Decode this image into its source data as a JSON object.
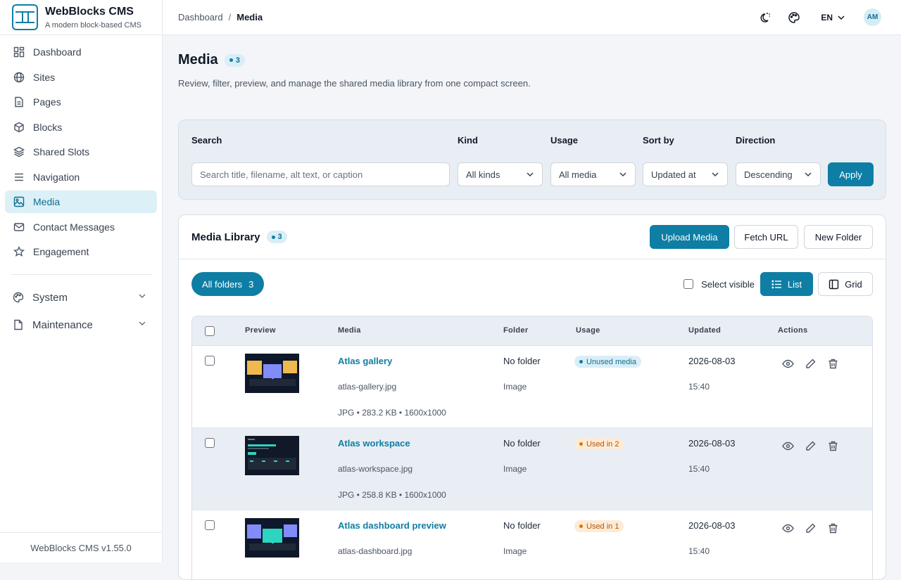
{
  "brand": {
    "name": "WebBlocks CMS",
    "tagline": "A modern block-based CMS",
    "version": "WebBlocks CMS v1.55.0"
  },
  "sidebar": {
    "items": [
      {
        "label": "Dashboard",
        "icon": "dashboard-grid-icon"
      },
      {
        "label": "Sites",
        "icon": "globe-icon"
      },
      {
        "label": "Pages",
        "icon": "document-icon"
      },
      {
        "label": "Blocks",
        "icon": "cube-icon"
      },
      {
        "label": "Shared Slots",
        "icon": "layers-icon"
      },
      {
        "label": "Navigation",
        "icon": "menu-lines-icon"
      },
      {
        "label": "Media",
        "icon": "image-icon",
        "active": true
      },
      {
        "label": "Contact Messages",
        "icon": "mail-icon"
      },
      {
        "label": "Engagement",
        "icon": "star-icon"
      }
    ],
    "groups": [
      {
        "label": "System",
        "icon": "palette-icon"
      },
      {
        "label": "Maintenance",
        "icon": "document-icon"
      }
    ]
  },
  "topbar": {
    "breadcrumb": {
      "parent": "Dashboard",
      "separator": "/",
      "current": "Media"
    },
    "language": "EN",
    "avatar_initials": "AM"
  },
  "page": {
    "title": "Media",
    "count": "3",
    "description": "Review, filter, preview, and manage the shared media library from one compact screen."
  },
  "filters": {
    "search_label": "Search",
    "search_placeholder": "Search title, filename, alt text, or caption",
    "kind_label": "Kind",
    "kind_value": "All kinds",
    "usage_label": "Usage",
    "usage_value": "All media",
    "sort_label": "Sort by",
    "sort_value": "Updated at",
    "direction_label": "Direction",
    "direction_value": "Descending",
    "apply_label": "Apply"
  },
  "library": {
    "title": "Media Library",
    "count": "3",
    "upload_label": "Upload Media",
    "fetch_label": "Fetch URL",
    "folder_label": "New Folder",
    "all_folders_label": "All folders",
    "all_folders_count": "3",
    "select_visible_label": "Select visible",
    "list_label": "List",
    "grid_label": "Grid",
    "view_mode": "list"
  },
  "table": {
    "headers": {
      "preview": "Preview",
      "media": "Media",
      "folder": "Folder",
      "usage": "Usage",
      "updated": "Updated",
      "actions": "Actions"
    },
    "rows": [
      {
        "title": "Atlas gallery",
        "file": "atlas-gallery.jpg",
        "meta": "JPG • 283.2 KB • 1600x1000",
        "folder": "No folder",
        "type": "Image",
        "usage": "Unused media",
        "usage_kind": "unused",
        "date": "2026-08-03",
        "time": "15:40",
        "thumb": "gallery"
      },
      {
        "title": "Atlas workspace",
        "file": "atlas-workspace.jpg",
        "meta": "JPG • 258.8 KB • 1600x1000",
        "folder": "No folder",
        "type": "Image",
        "usage": "Used in 2",
        "usage_kind": "used",
        "date": "2026-08-03",
        "time": "15:40",
        "thumb": "workspace"
      },
      {
        "title": "Atlas dashboard preview",
        "file": "atlas-dashboard.jpg",
        "meta": "",
        "folder": "No folder",
        "type": "Image",
        "usage": "Used in 1",
        "usage_kind": "used",
        "date": "2026-08-03",
        "time": "15:40",
        "thumb": "dashboard"
      }
    ]
  },
  "colors": {
    "accent": "#0e7ea4",
    "accent_bg": "#dcf0f7",
    "used_badge": "#fdebd6",
    "unused_badge": "#d9eef7"
  }
}
